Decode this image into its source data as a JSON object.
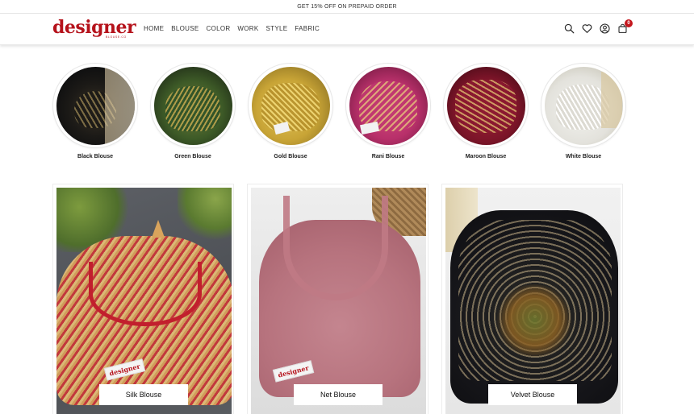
{
  "announcement": "GET 15% OFF ON PREPAID ORDER",
  "brand": {
    "name": "designer",
    "tagline": "BLOUSE.CO",
    "color": "#b5121b"
  },
  "nav": [
    "HOME",
    "BLOUSE",
    "COLOR",
    "WORK",
    "STYLE",
    "FABRIC"
  ],
  "icons": {
    "search": "search-icon",
    "wishlist": "heart-icon",
    "account": "user-icon",
    "cart": "bag-icon"
  },
  "cart_count": "0",
  "categories": [
    {
      "label": "Black Blouse"
    },
    {
      "label": "Green Blouse"
    },
    {
      "label": "Gold Blouse"
    },
    {
      "label": "Rani Blouse"
    },
    {
      "label": "Maroon Blouse"
    },
    {
      "label": "White Blouse"
    }
  ],
  "products": [
    {
      "label": "Silk Blouse",
      "tag": "designer"
    },
    {
      "label": "Net Blouse",
      "tag": "designer"
    },
    {
      "label": "Velvet Blouse"
    }
  ]
}
